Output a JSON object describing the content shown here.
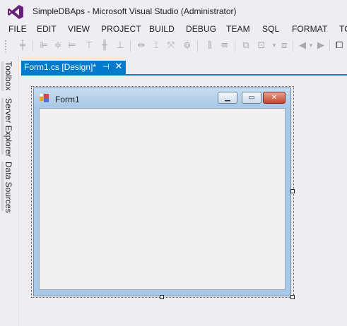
{
  "window": {
    "title": "SimpleDBAps - Microsoft Visual Studio (Administrator)"
  },
  "menu": {
    "items": [
      "FILE",
      "EDIT",
      "VIEW",
      "PROJECT",
      "BUILD",
      "DEBUG",
      "TEAM",
      "SQL",
      "FORMAT",
      "TO"
    ]
  },
  "side_panels": {
    "toolbox": "Toolbox",
    "server_explorer": "Server Explorer",
    "data_sources": "Data Sources"
  },
  "document_tab": {
    "label": "Form1.cs [Design]*"
  },
  "form": {
    "title": "Form1"
  },
  "colors": {
    "accent": "#007acc",
    "background": "#eeeef2"
  }
}
